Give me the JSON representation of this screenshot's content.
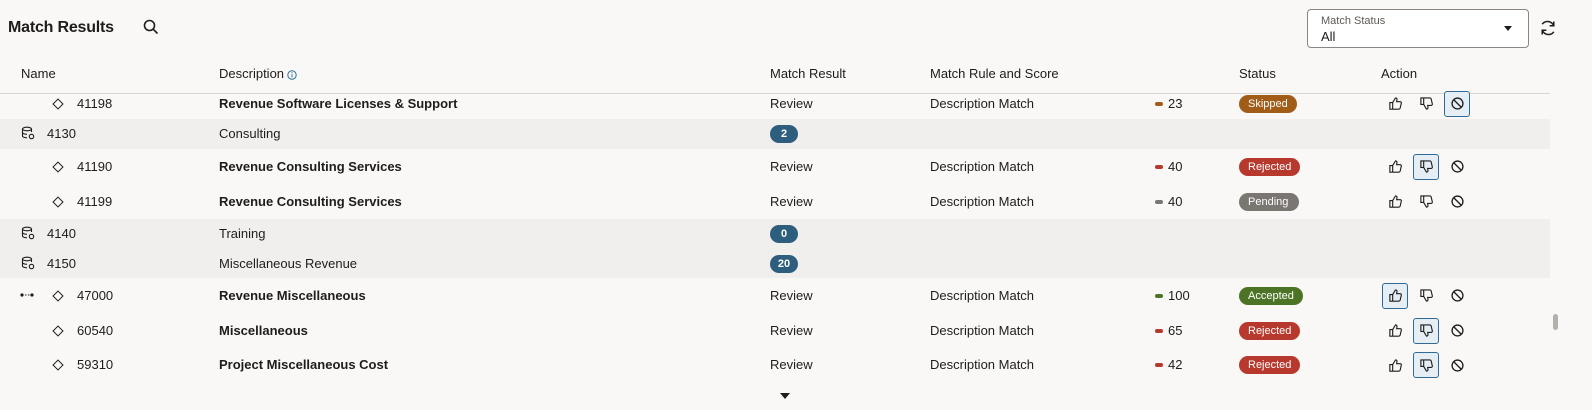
{
  "title": "Match Results",
  "filter": {
    "label": "Match Status",
    "value": "All"
  },
  "columns": {
    "name": "Name",
    "description": "Description",
    "match_result": "Match Result",
    "match_rule": "Match Rule and Score",
    "status": "Status",
    "action": "Action"
  },
  "colors": {
    "accepted": "#4d7426",
    "rejected": "#b7382c",
    "pending": "#7a7672",
    "skipped": "#a15c17",
    "badge": "#2d5e7e"
  },
  "rows": [
    {
      "type": "item",
      "name": "41198",
      "description": "Revenue Software Licenses & Support",
      "match_result": "Review",
      "rule": "Description Match",
      "score": "23",
      "status": "Skipped",
      "selected_action": "skip"
    },
    {
      "type": "group",
      "name": "4130",
      "description": "Consulting",
      "count": "2"
    },
    {
      "type": "item",
      "name": "41190",
      "description": "Revenue Consulting Services",
      "match_result": "Review",
      "rule": "Description Match",
      "score": "40",
      "status": "Rejected",
      "selected_action": "reject"
    },
    {
      "type": "item",
      "name": "41199",
      "description": "Revenue Consulting Services",
      "match_result": "Review",
      "rule": "Description Match",
      "score": "40",
      "status": "Pending",
      "selected_action": ""
    },
    {
      "type": "group",
      "name": "4140",
      "description": "Training",
      "count": "0"
    },
    {
      "type": "group",
      "name": "4150",
      "description": "Miscellaneous Revenue",
      "count": "20"
    },
    {
      "type": "item",
      "name": "47000",
      "description": "Revenue Miscellaneous",
      "match_result": "Review",
      "rule": "Description Match",
      "score": "100",
      "status": "Accepted",
      "selected_action": "accept",
      "linked": true
    },
    {
      "type": "item",
      "name": "60540",
      "description": "Miscellaneous",
      "match_result": "Review",
      "rule": "Description Match",
      "score": "65",
      "status": "Rejected",
      "selected_action": "reject"
    },
    {
      "type": "item",
      "name": "59310",
      "description": "Project Miscellaneous Cost",
      "match_result": "Review",
      "rule": "Description Match",
      "score": "42",
      "status": "Rejected",
      "selected_action": "reject"
    }
  ]
}
